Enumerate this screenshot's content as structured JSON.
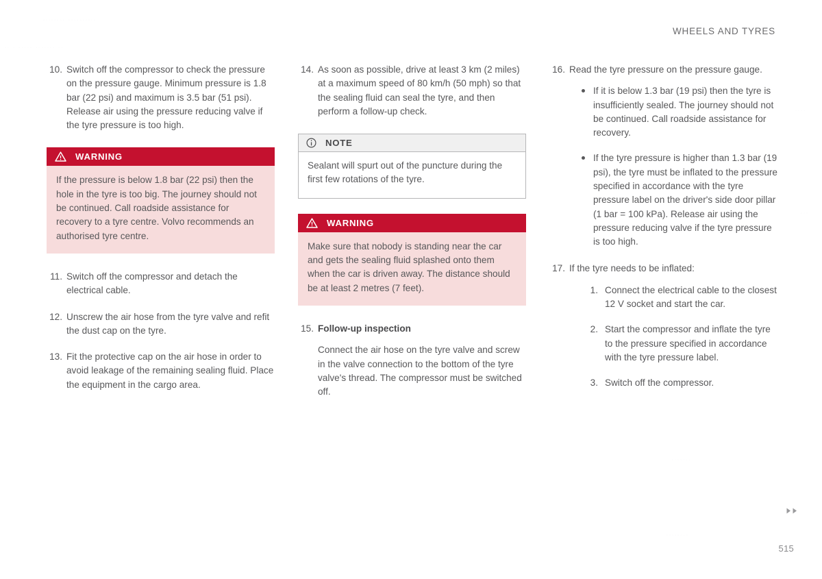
{
  "header": {
    "section_title": "WHEELS AND TYRES"
  },
  "ghost_text": {
    "a": "........ ..........",
    "b": ".. . ..... .......  ..",
    "c": "....",
    "d": "...",
    "e": ".......",
    "f": "........"
  },
  "columns": [
    {
      "id": "column-1",
      "blocks": [
        {
          "kind": "step",
          "number": "10.",
          "text": "Switch off the compressor to check the pressure on the pressure gauge. Minimum pressure is 1.8 bar (22 psi) and maximum is 3.5 bar (51 psi). Release air using the pressure reducing valve if the tyre pressure is too high."
        },
        {
          "kind": "warning",
          "icon": "warning-triangle-icon",
          "label": "WARNING",
          "text": "If the pressure is below 1.8 bar (22 psi) then the hole in the tyre is too big. The journey should not be continued. Call roadside assistance for recovery to a tyre centre. Volvo recommends an authorised tyre centre."
        },
        {
          "kind": "step",
          "number": "11.",
          "text": "Switch off the compressor and detach the electrical cable."
        },
        {
          "kind": "step",
          "number": "12.",
          "text": "Unscrew the air hose from the tyre valve and refit the dust cap on the tyre."
        },
        {
          "kind": "step",
          "number": "13.",
          "text": "Fit the protective cap on the air hose in order to avoid leakage of the remaining sealing fluid. Place the equipment in the cargo area."
        }
      ]
    },
    {
      "id": "column-2",
      "blocks": [
        {
          "kind": "step",
          "number": "14.",
          "text": "As soon as possible, drive at least 3 km (2 miles) at a maximum speed of 80 km/h (50 mph) so that the sealing fluid can seal the tyre, and then perform a follow-up check."
        },
        {
          "kind": "note",
          "icon": "info-circle-icon",
          "label": "NOTE",
          "text": "Sealant will spurt out of the puncture during the first few rotations of the tyre."
        },
        {
          "kind": "warning",
          "icon": "warning-triangle-icon",
          "label": "WARNING",
          "text": "Make sure that nobody is standing near the car and gets the sealing fluid splashed onto them when the car is driven away. The distance should be at least 2 metres (7 feet)."
        },
        {
          "kind": "step-titled",
          "number": "15.",
          "title": "Follow-up inspection",
          "text": "Connect the air hose on the tyre valve and screw in the valve connection to the bottom of the tyre valve's thread. The compressor must be switched off."
        }
      ]
    },
    {
      "id": "column-3",
      "blocks": [
        {
          "kind": "step-with-bullets",
          "number": "16.",
          "text": "Read the tyre pressure on the pressure gauge.",
          "bullets": [
            "If it is below 1.3 bar (19 psi) then the tyre is insufficiently sealed. The journey should not be continued. Call roadside assistance for recovery.",
            "If the tyre pressure is higher than 1.3 bar (19 psi), the tyre must be inflated to the pressure specified in accordance with the tyre pressure label on the driver's side door pillar (1 bar = 100 kPa). Release air using the pressure reducing valve if the tyre pressure is too high."
          ]
        },
        {
          "kind": "step-with-substeps",
          "number": "17.",
          "text": "If the tyre needs to be inflated:",
          "substeps": [
            {
              "number": "1.",
              "text": "Connect the electrical cable to the closest 12 V socket and start the car."
            },
            {
              "number": "2.",
              "text": "Start the compressor and inflate the tyre to the pressure specified in accordance with the tyre pressure label."
            },
            {
              "number": "3.",
              "text": "Switch off the compressor."
            }
          ]
        }
      ]
    }
  ],
  "footer": {
    "continuation_icon": "double-chevron-right-icon",
    "page_number": "515"
  },
  "colors": {
    "warning_header": "#c4112f",
    "warning_body": "#f7dcdc",
    "note_header": "#f0f0f0",
    "note_border": "#b6b6b8",
    "body_text": "#58585a"
  }
}
